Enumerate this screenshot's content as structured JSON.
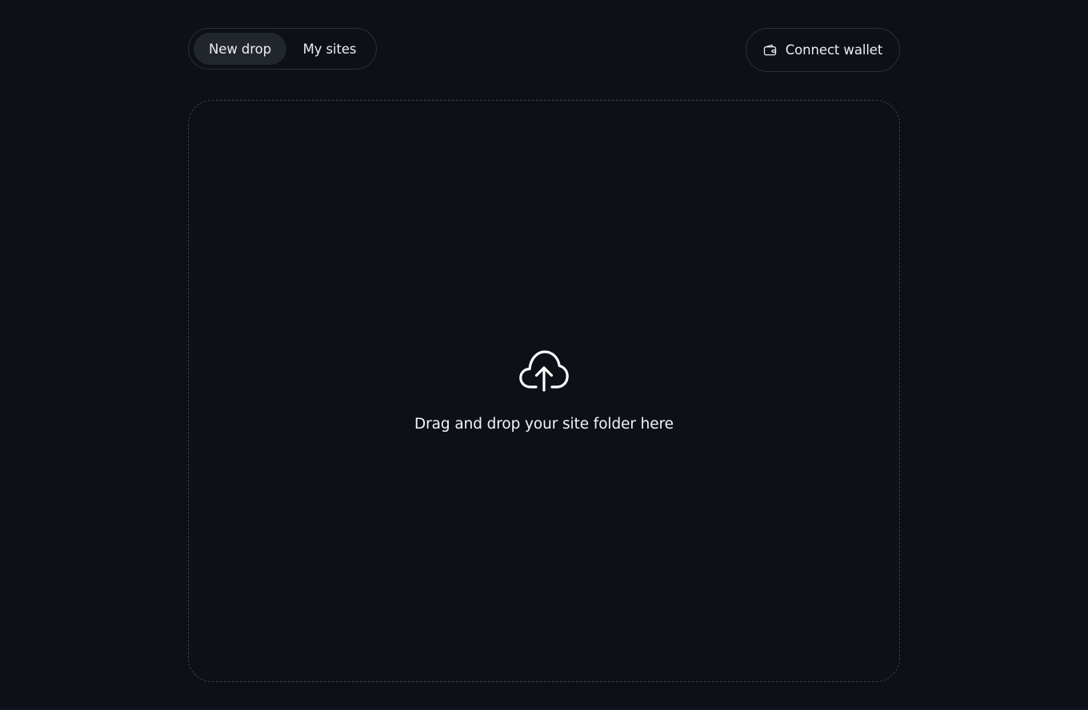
{
  "nav": {
    "tabs": [
      {
        "label": "New drop",
        "active": true
      },
      {
        "label": "My sites",
        "active": false
      }
    ]
  },
  "wallet": {
    "label": "Connect wallet",
    "icon": "wallet-icon"
  },
  "dropzone": {
    "icon": "cloud-upload-icon",
    "label": "Drag and drop your site folder here"
  },
  "colors": {
    "background": "#0d1017",
    "border": "#2b2f37",
    "active_tab": "#22262d",
    "text": "#eceef1"
  }
}
